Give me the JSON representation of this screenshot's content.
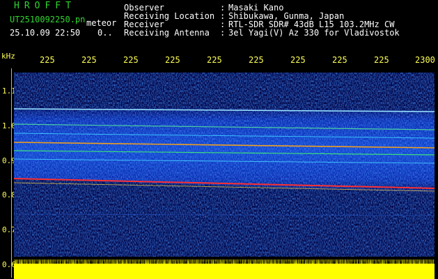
{
  "header": {
    "brand": "HROFFT",
    "filename": "UT2510092250.pn",
    "kind": "meteor",
    "datetime": "25.10.09 22:50",
    "value": "0..",
    "info": [
      {
        "label": "Observer",
        "value": "Masaki Kano"
      },
      {
        "label": "Receiving Location",
        "value": "Shibukawa, Gunma, Japan"
      },
      {
        "label": "Receiver",
        "value": "RTL-SDR SDR# 43dB L15 103.2MHz CW"
      },
      {
        "label": "Receiving Antenna",
        "value": "3el Yagi(V) Az 330 for Vladivostok"
      }
    ],
    "separator": ":"
  },
  "axes": {
    "y_unit": "kHz",
    "y_ticks": [
      "1.1",
      "1.0",
      "0.9",
      "0.8",
      "0.7",
      "0.6"
    ],
    "x_ticks": [
      "225",
      "225",
      "225",
      "225",
      "225",
      "225",
      "225",
      "225",
      "225",
      "2300"
    ]
  },
  "colors": {
    "green_text": "#31d531",
    "white_text": "#ffffff",
    "axis_text": "#ffff55",
    "bar": "#ffff00",
    "background": "#000000"
  }
}
